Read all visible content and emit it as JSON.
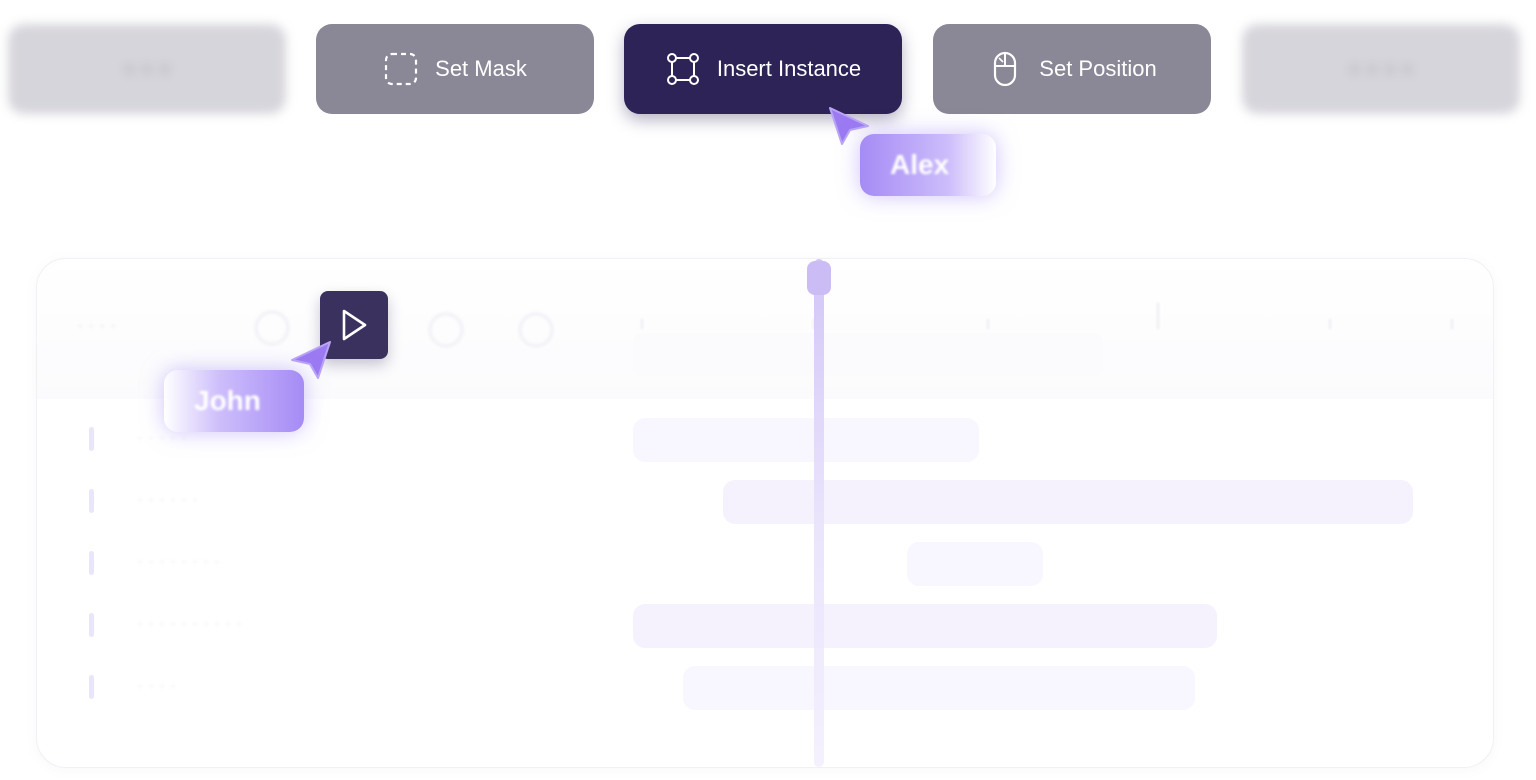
{
  "toolbar": {
    "buttons": [
      {
        "id": "ghost-left",
        "label": "",
        "icon": "blurred-icon",
        "state": "ghost"
      },
      {
        "id": "set-mask",
        "label": "Set Mask",
        "icon": "dashed-square-icon",
        "state": "normal"
      },
      {
        "id": "insert-instance",
        "label": "Insert Instance",
        "icon": "node-square-icon",
        "state": "active"
      },
      {
        "id": "set-position",
        "label": "Set Position",
        "icon": "mouse-icon",
        "state": "normal"
      },
      {
        "id": "ghost-right",
        "label": "",
        "icon": "blurred-icon",
        "state": "ghost"
      }
    ]
  },
  "collaborators": [
    {
      "name": "Alex",
      "color": "#9b7af2"
    },
    {
      "name": "John",
      "color": "#9b7af2"
    }
  ],
  "timeline": {
    "play_icon": "play-icon",
    "tracks": [
      {
        "id": "track-1"
      },
      {
        "id": "track-2"
      },
      {
        "id": "track-3"
      },
      {
        "id": "track-4"
      },
      {
        "id": "track-5"
      }
    ]
  },
  "colors": {
    "accent": "#2d2357",
    "button_gray": "#8a8796",
    "cursor": "#9b7af2",
    "playhead": "#d8cbf8"
  }
}
